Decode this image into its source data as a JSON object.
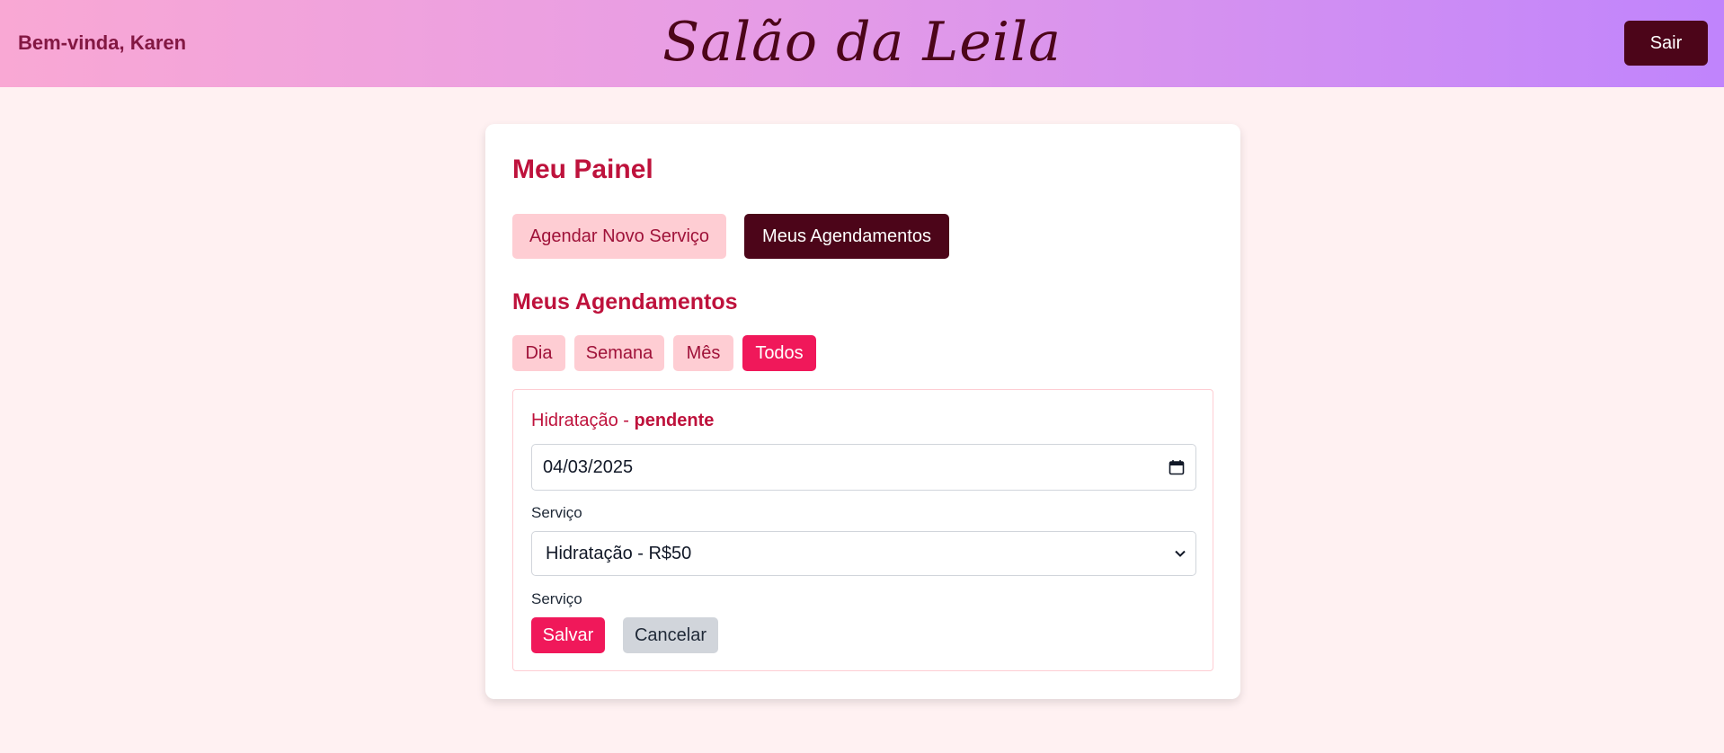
{
  "header": {
    "greeting": "Bem-vinda, Karen",
    "brand": "Salão da Leila",
    "logout_label": "Sair"
  },
  "panel": {
    "title": "Meu Painel",
    "tabs": [
      {
        "label": "Agendar Novo Serviço",
        "active": false
      },
      {
        "label": "Meus Agendamentos",
        "active": true
      }
    ]
  },
  "appointments": {
    "title": "Meus Agendamentos",
    "filters": [
      {
        "label": "Dia",
        "active": false
      },
      {
        "label": "Semana",
        "active": false
      },
      {
        "label": "Mês",
        "active": false
      },
      {
        "label": "Todos",
        "active": true
      }
    ],
    "items": [
      {
        "service": "Hidratação",
        "separator": " - ",
        "status": "pendente",
        "date_value": "04/03/2025",
        "service_label": "Serviço",
        "service_select_value": "Hidratação - R$50",
        "second_label": "Serviço",
        "save_label": "Salvar",
        "cancel_label": "Cancelar"
      }
    ]
  },
  "icons": {
    "date_picker": "calendar-icon",
    "select_arrow": "chevron-down-icon"
  },
  "colors": {
    "accent": "#be123c",
    "dark": "#4c0519",
    "primary_button": "#f0185a",
    "soft_pink": "#fecdd3",
    "background": "#fff1f2",
    "header_gradient_start": "#f9a8d4",
    "header_gradient_end": "#c084fc"
  }
}
